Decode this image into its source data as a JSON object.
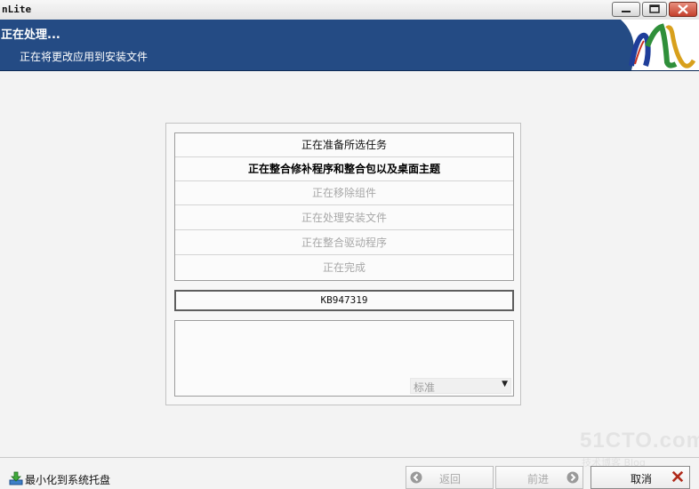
{
  "window": {
    "title": "nLite",
    "controls": {
      "minimize": "minimize-icon",
      "maximize": "maximize-icon",
      "close": "close-icon"
    }
  },
  "header": {
    "title": "正在处理...",
    "subtitle": "正在将更改应用到安装文件",
    "logo": "nlite-logo"
  },
  "tasks": [
    {
      "label": "正在准备所选任务",
      "state": "done"
    },
    {
      "label": "正在整合修补程序和整合包以及桌面主题",
      "state": "active"
    },
    {
      "label": "正在移除组件",
      "state": "pending"
    },
    {
      "label": "正在处理安装文件",
      "state": "pending"
    },
    {
      "label": "正在整合驱动程序",
      "state": "pending"
    },
    {
      "label": "正在完成",
      "state": "pending"
    }
  ],
  "current_item": "KB947319",
  "priority": {
    "selected": "标准"
  },
  "footer": {
    "tray_label": "最小化到系统托盘",
    "back_label": "返回",
    "next_label": "前进",
    "cancel_label": "取消"
  },
  "watermark": {
    "main": "51CTO.com",
    "sub": "技术博客  Blog"
  },
  "colors": {
    "header_bg": "#244b84",
    "close_button": "#c4402c",
    "cancel_icon": "#b02a1a",
    "nav_icon": "#9a9a9a"
  }
}
